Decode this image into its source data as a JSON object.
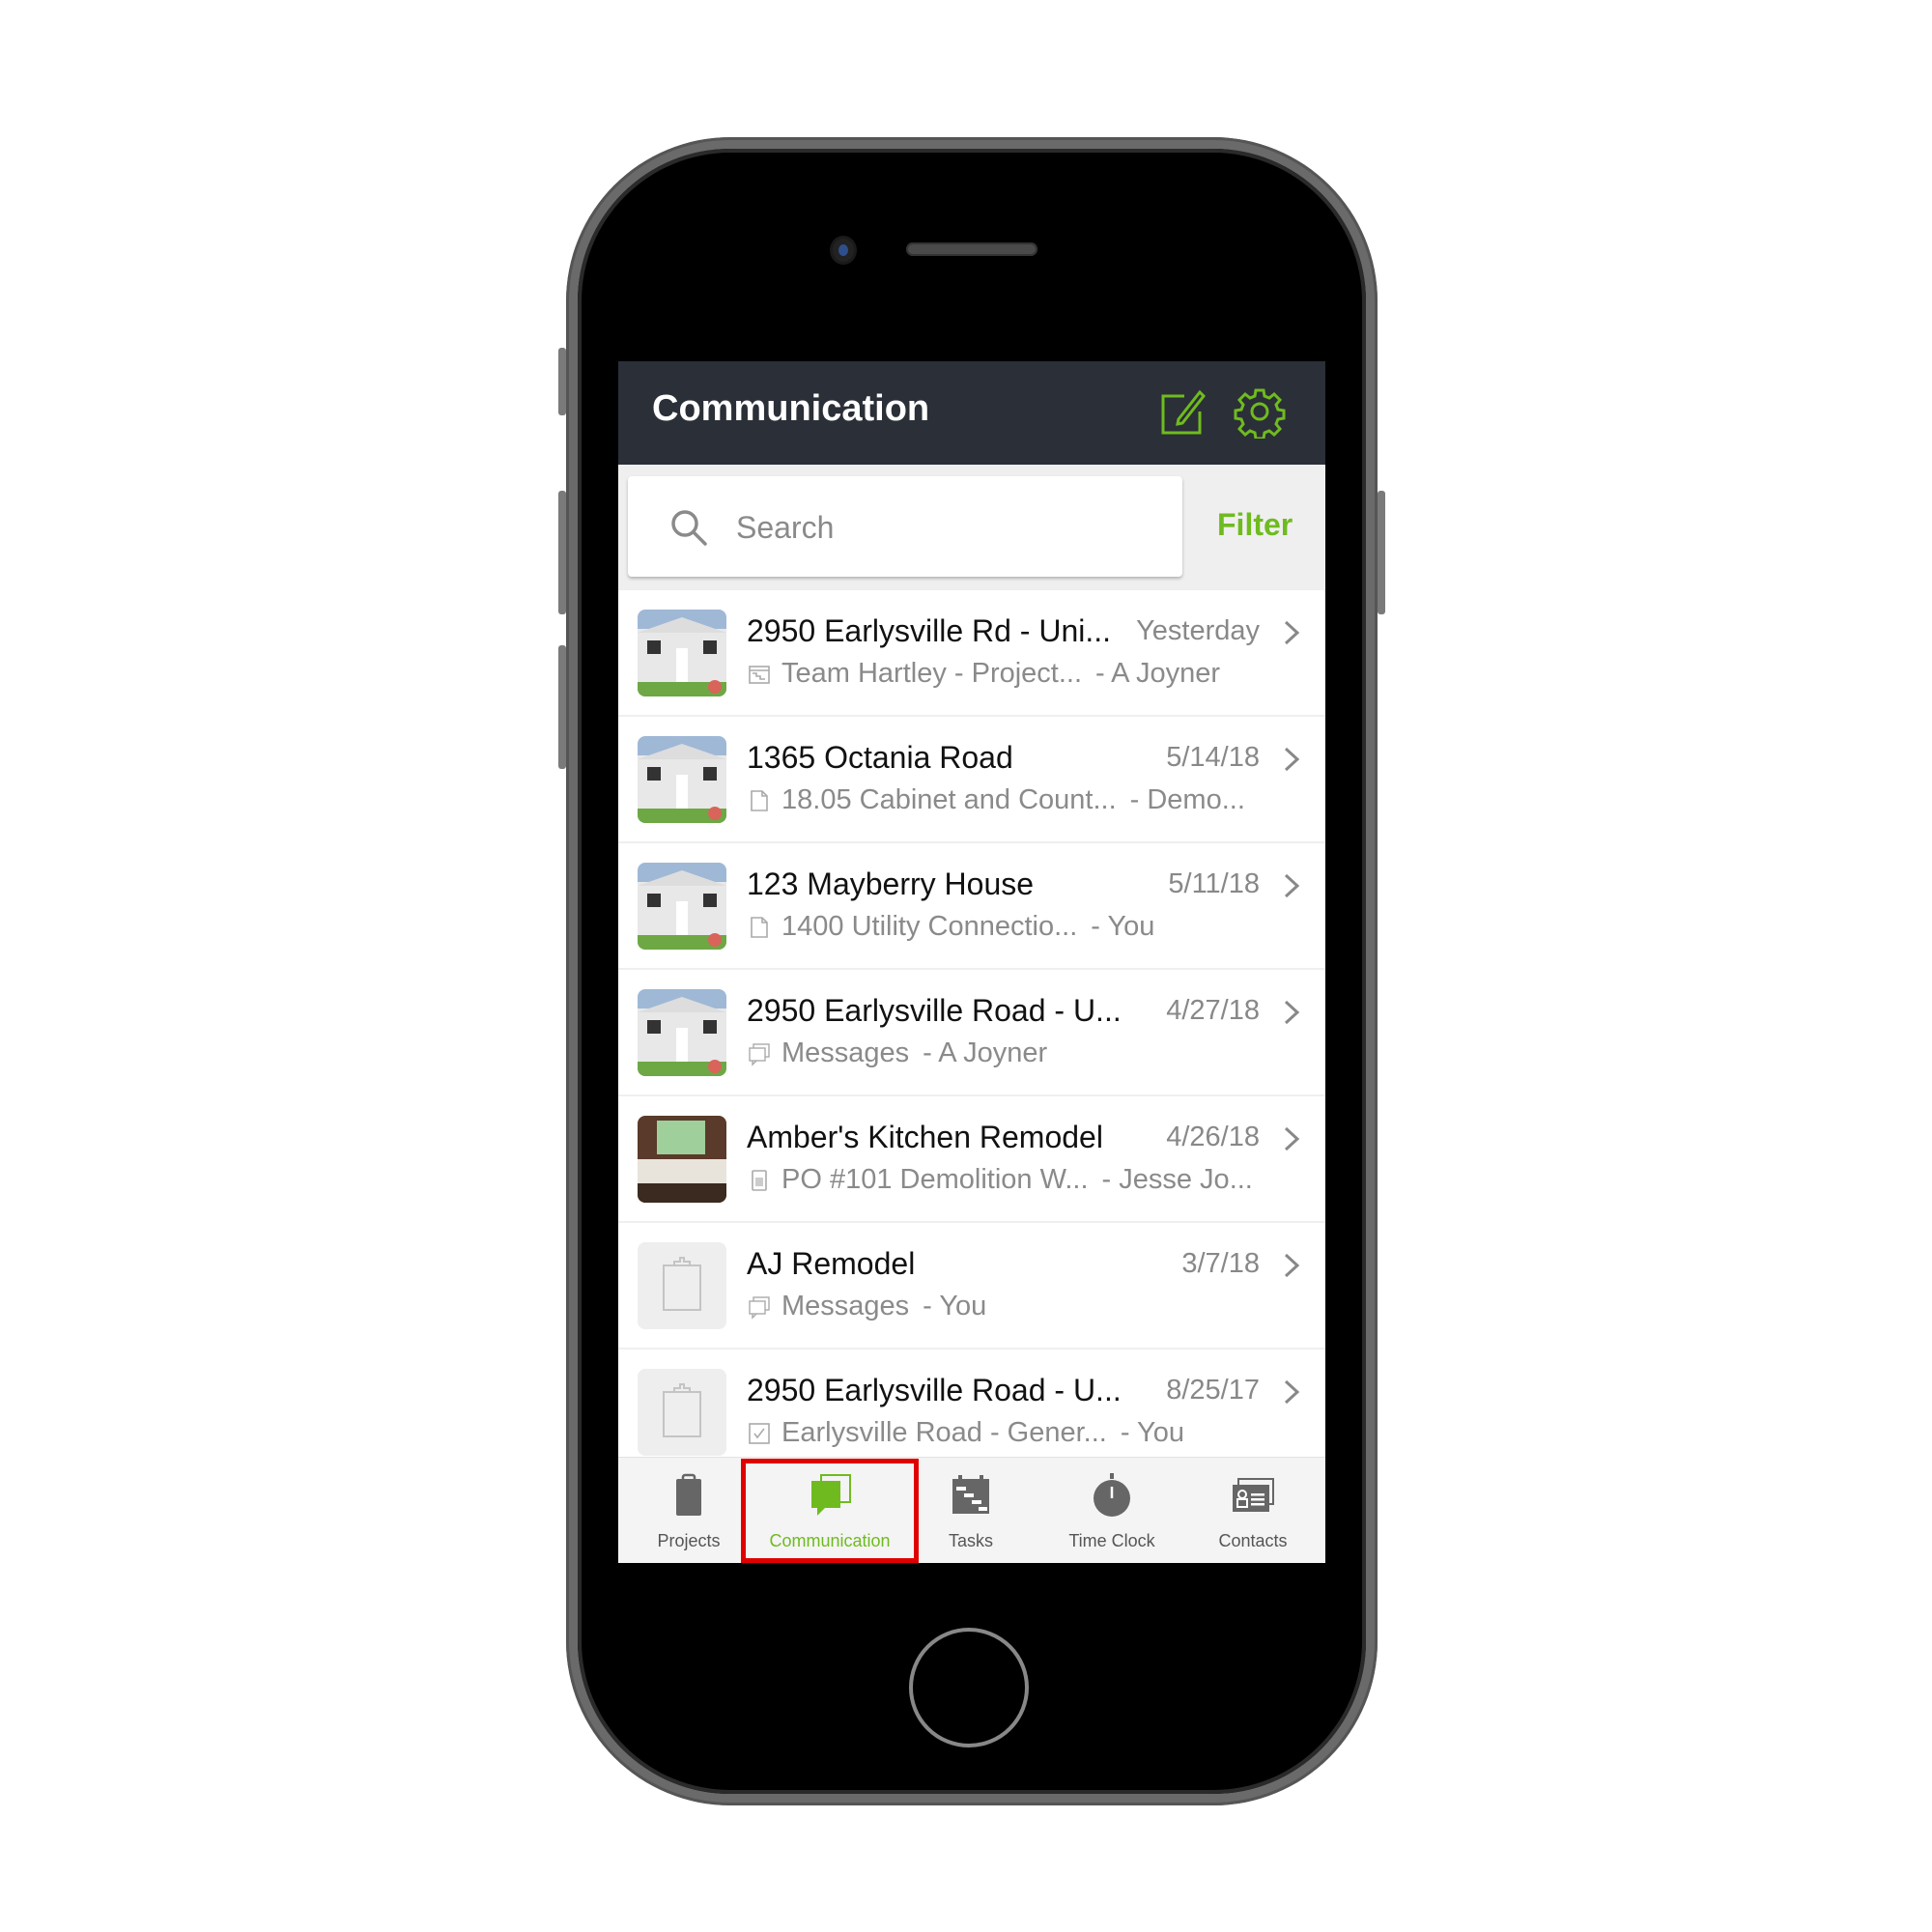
{
  "header": {
    "title": "Communication",
    "compose_icon": "compose-icon",
    "settings_icon": "gear-icon"
  },
  "search": {
    "placeholder": "Search",
    "value": "",
    "filter_label": "Filter"
  },
  "conversations": [
    {
      "title": "2950 Earlysville Rd - Uni...",
      "date": "Yesterday",
      "type_icon": "schedule-icon",
      "subject": "Team Hartley - Project...",
      "author": "- A Joyner",
      "thumb": "house-photo"
    },
    {
      "title": "1365 Octania Road",
      "date": "5/14/18",
      "type_icon": "document-icon",
      "subject": "18.05 Cabinet and Count...",
      "author": "- Demo...",
      "thumb": "house-photo"
    },
    {
      "title": "123 Mayberry House",
      "date": "5/11/18",
      "type_icon": "document-icon",
      "subject": "1400 Utility Connectio...",
      "author": "- You",
      "thumb": "house-photo"
    },
    {
      "title": "2950 Earlysville Road - U...",
      "date": "4/27/18",
      "type_icon": "message-icon",
      "subject": "Messages",
      "author": "- A Joyner",
      "thumb": "house-photo"
    },
    {
      "title": "Amber's Kitchen Remodel",
      "date": "4/26/18",
      "type_icon": "purchase-order-icon",
      "subject": "PO #101 Demolition W...",
      "author": "- Jesse Jo...",
      "thumb": "kitchen-photo"
    },
    {
      "title": "AJ Remodel",
      "date": "3/7/18",
      "type_icon": "message-icon",
      "subject": "Messages",
      "author": "- You",
      "thumb": "clipboard-placeholder"
    },
    {
      "title": "2950 Earlysville Road - U...",
      "date": "8/25/17",
      "type_icon": "checkbox-icon",
      "subject": "Earlysville Road - Gener...",
      "author": "- You",
      "thumb": "clipboard-placeholder"
    }
  ],
  "tabs": [
    {
      "label": "Projects",
      "icon": "clipboard-icon",
      "active": false
    },
    {
      "label": "Communication",
      "icon": "chat-icon",
      "active": true
    },
    {
      "label": "Tasks",
      "icon": "tasks-calendar-icon",
      "active": false
    },
    {
      "label": "Time Clock",
      "icon": "stopwatch-icon",
      "active": false
    },
    {
      "label": "Contacts",
      "icon": "contact-card-icon",
      "active": false
    }
  ],
  "colors": {
    "accent": "#6fbb1f",
    "header_bg": "#2b2f37",
    "highlight": "#e00000",
    "tab_icon": "#666666"
  }
}
